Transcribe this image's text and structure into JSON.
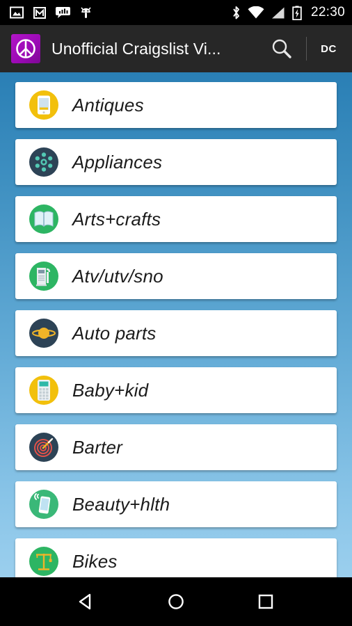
{
  "statusbar": {
    "time": "22:30",
    "left_icons": [
      {
        "name": "photo-icon"
      },
      {
        "name": "gmail-icon"
      },
      {
        "name": "chat-bars-icon"
      },
      {
        "name": "android-bug-icon"
      }
    ],
    "right_icons": [
      {
        "name": "bluetooth-icon"
      },
      {
        "name": "wifi-icon"
      },
      {
        "name": "cell-signal-icon"
      },
      {
        "name": "battery-charging-icon"
      }
    ]
  },
  "appbar": {
    "logo_name": "peace-sign-logo",
    "title": "Unofficial Craigslist Vi...",
    "search_label": "search-icon",
    "location": "DC",
    "bg_color": "#272727",
    "logo_color": "#9a09b4"
  },
  "list": {
    "bg_top_color": "#2a7fb5",
    "bg_bottom_color": "#9bcfee",
    "items": [
      {
        "label": "Antiques",
        "icon": "phone-icon",
        "circle": "#f2c00c",
        "glyph": "#ffffff"
      },
      {
        "label": "Appliances",
        "icon": "atom-icon",
        "circle": "#2d4356",
        "glyph": "#53c9b4"
      },
      {
        "label": "Arts+crafts",
        "icon": "open-book-icon",
        "circle": "#2db563",
        "glyph": "#dff2f7"
      },
      {
        "label": "Atv/utv/sno",
        "icon": "gas-pump-icon",
        "circle": "#2db563",
        "glyph": "#e8edf0"
      },
      {
        "label": "Auto parts",
        "icon": "saturn-icon",
        "circle": "#2d4356",
        "glyph": "#f0b428"
      },
      {
        "label": "Baby+kid",
        "icon": "calculator-icon",
        "circle": "#f2c00c",
        "glyph": "#eef2f4"
      },
      {
        "label": "Barter",
        "icon": "dartboard-icon",
        "circle": "#2d4356",
        "glyph": "#e0524a"
      },
      {
        "label": "Beauty+hlth",
        "icon": "phone-vibrate-icon",
        "circle": "#3ab878",
        "glyph": "#ffffff"
      },
      {
        "label": "Bikes",
        "icon": "crane-scale-icon",
        "circle": "#2db563",
        "glyph": "#f0b428"
      }
    ]
  },
  "navbar": {
    "back_label": "back-button",
    "home_label": "home-button",
    "recents_label": "recents-button"
  }
}
